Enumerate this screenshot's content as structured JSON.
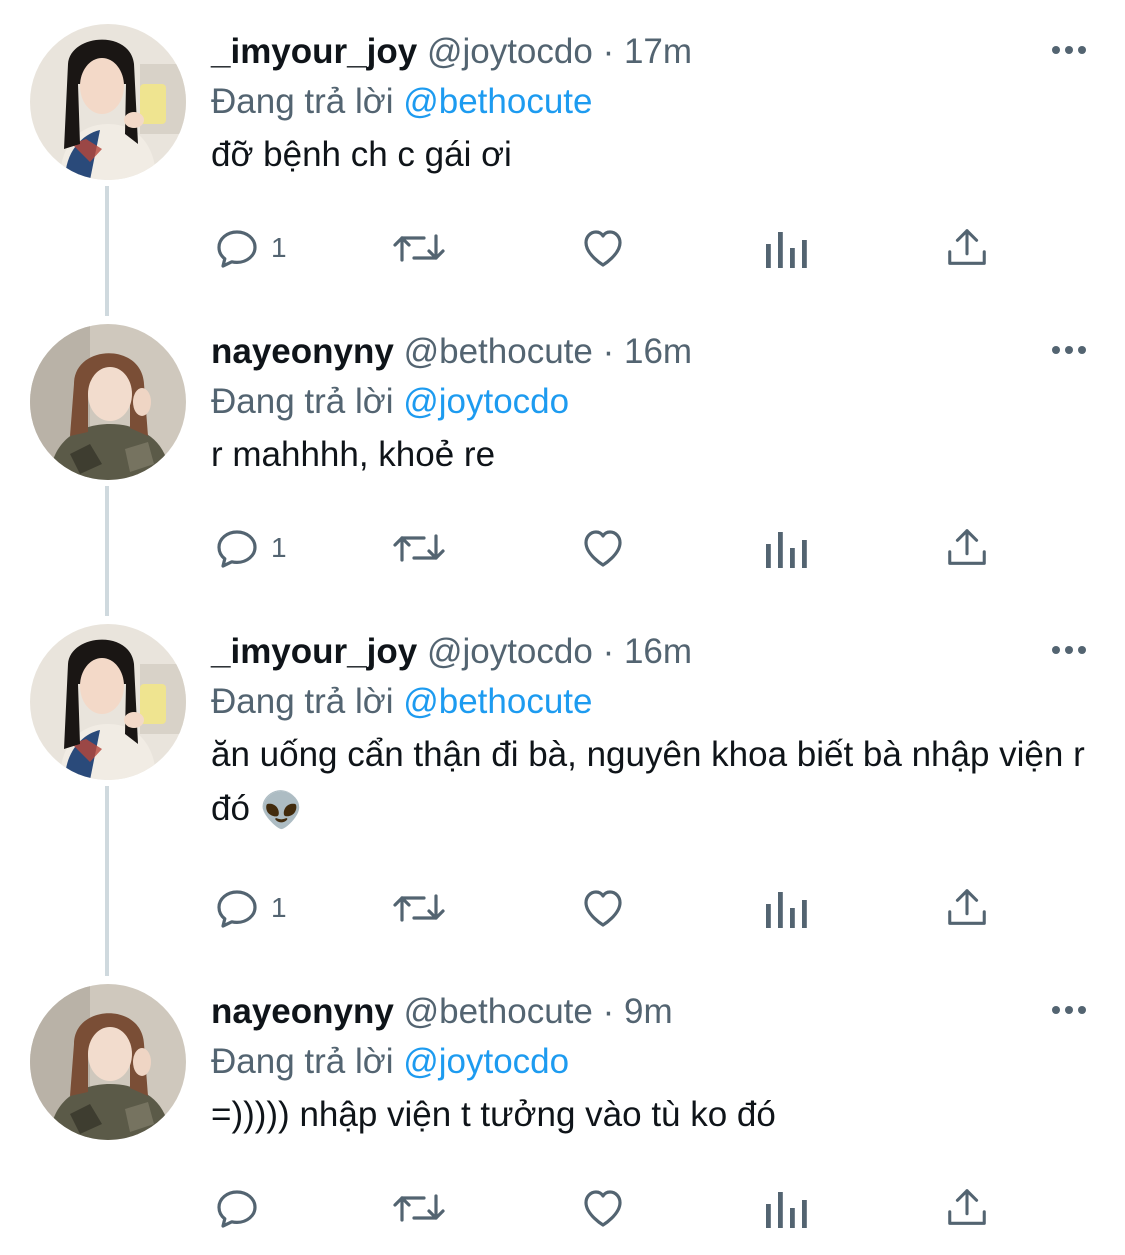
{
  "colors": {
    "text": "#0f1419",
    "muted": "#536471",
    "link": "#1d9bf0",
    "thread_line": "#cfd9de"
  },
  "tweets": [
    {
      "display_name": "_imyour_joy",
      "handle": "@joytocdo",
      "time": "· 17m",
      "replying_label": "Đang trả lời",
      "replying_to": "@bethocute",
      "text": "đỡ bệnh ch c gái ơi",
      "text_suffix": "",
      "reply_count": "1",
      "avatar": "avatar-joy"
    },
    {
      "display_name": "nayeonyny",
      "handle": "@bethocute",
      "time": "· 16m",
      "replying_label": "Đang trả lời",
      "replying_to": "@joytocdo",
      "text": "r mahhhh, khoẻ re",
      "text_suffix": "",
      "reply_count": "1",
      "avatar": "avatar-nayeon"
    },
    {
      "display_name": "_imyour_joy",
      "handle": "@joytocdo",
      "time": "· 16m",
      "replying_label": "Đang trả lời",
      "replying_to": "@bethocute",
      "text": "ăn uống cẩn thận đi bà, nguyên khoa biết bà nhập viện r đó",
      "text_suffix": "👽",
      "reply_count": "1",
      "avatar": "avatar-joy"
    },
    {
      "display_name": "nayeonyny",
      "handle": "@bethocute",
      "time": "· 9m",
      "replying_label": "Đang trả lời",
      "replying_to": "@joytocdo",
      "text": "=))))) nhập viện t tưởng vào tù ko đó",
      "text_suffix": "",
      "reply_count": "",
      "avatar": "avatar-nayeon"
    }
  ],
  "icons": [
    "reply-icon",
    "retweet-icon",
    "like-icon",
    "views-icon",
    "share-icon",
    "more-icon",
    "alien-emoji"
  ]
}
